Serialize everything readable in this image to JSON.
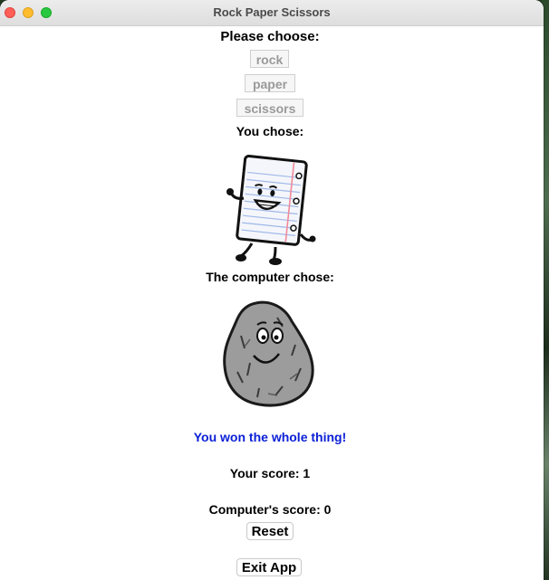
{
  "window": {
    "title": "Rock Paper Scissors"
  },
  "prompt": {
    "heading": "Please choose:"
  },
  "choices": [
    {
      "label": "rock"
    },
    {
      "label": "paper"
    },
    {
      "label": "scissors"
    }
  ],
  "user": {
    "label": "You chose:",
    "choice_icon": "paper-character-icon"
  },
  "computer": {
    "label": "The computer chose:",
    "choice_icon": "rock-character-icon"
  },
  "result": {
    "message": "You won the whole thing!",
    "color": "#0a1fd6"
  },
  "scores": {
    "user": "Your score: 1",
    "computer": "Computer's score: 0"
  },
  "buttons": {
    "reset": "Reset",
    "exit": "Exit App"
  }
}
